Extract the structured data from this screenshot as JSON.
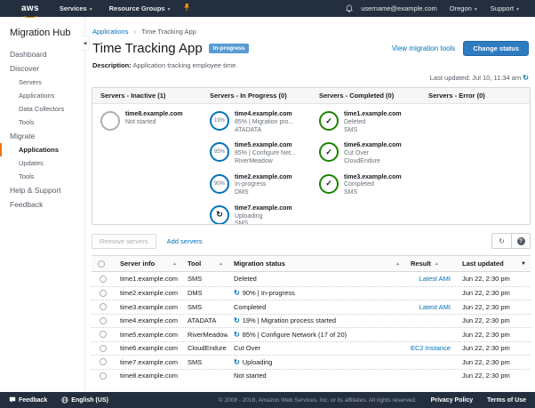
{
  "colors": {
    "nav_bg": "#232f3e",
    "accent_orange": "#ec7211",
    "aws_smile": "#ff9900",
    "link_blue": "#0073bb",
    "primary_button": "#2d7bc0",
    "badge_blue": "#5a9bd5",
    "progress_ring": "#0073bb",
    "complete_ring": "#1d8102",
    "inactive_ring": "#aab0b5"
  },
  "topnav": {
    "logo": "aws",
    "services": "Services",
    "resource_groups": "Resource Groups",
    "user": "username@example.com",
    "region": "Oregon",
    "support": "Support"
  },
  "sidebar": {
    "title": "Migration Hub",
    "items": [
      {
        "label": "Dashboard",
        "level": 0,
        "active": false
      },
      {
        "label": "Discover",
        "level": 0,
        "active": false
      },
      {
        "label": "Servers",
        "level": 1,
        "active": false
      },
      {
        "label": "Applications",
        "level": 1,
        "active": false
      },
      {
        "label": "Data Collectors",
        "level": 1,
        "active": false
      },
      {
        "label": "Tools",
        "level": 1,
        "active": false
      },
      {
        "label": "Migrate",
        "level": 0,
        "active": false
      },
      {
        "label": "Applications",
        "level": 1,
        "active": true
      },
      {
        "label": "Updates",
        "level": 1,
        "active": false
      },
      {
        "label": "Tools",
        "level": 1,
        "active": false
      },
      {
        "label": "Help & Support",
        "level": 0,
        "active": false
      },
      {
        "label": "Feedback",
        "level": 0,
        "active": false
      }
    ]
  },
  "header": {
    "breadcrumb_parent": "Applications",
    "breadcrumb_current": "Time Tracking App",
    "title": "Time Tracking App",
    "status_badge": "In-progress",
    "view_tools_link": "View migration tools",
    "change_status_button": "Change status",
    "description_label": "Description:",
    "description": "Application tracking employee time.",
    "last_updated": "Last updated: Jul 10, 11:34 am"
  },
  "status_panel": {
    "columns": [
      {
        "header": "Servers - Inactive (1)",
        "servers": [
          {
            "name": "time8.example.com",
            "line2": "Not started",
            "line3": "",
            "icon": "empty",
            "percent": ""
          }
        ]
      },
      {
        "header": "Servers - In Progress (0)",
        "servers": [
          {
            "name": "time4.example.com",
            "line2": "85% | Migration pro...",
            "line3": "ATADATA",
            "icon": "percent",
            "percent": "19%"
          },
          {
            "name": "time5.example.com",
            "line2": "85% | Configure Net...",
            "line3": "RiverMeadow",
            "icon": "percent",
            "percent": "85%"
          },
          {
            "name": "time2.example.com",
            "line2": "In-progress",
            "line3": "DMS",
            "icon": "percent",
            "percent": "90%"
          },
          {
            "name": "time7.example.com",
            "line2": "Uploading",
            "line3": "SMS",
            "icon": "refresh",
            "percent": ""
          }
        ]
      },
      {
        "header": "Servers - Completed (0)",
        "servers": [
          {
            "name": "time1.example.com",
            "line2": "Deleted",
            "line3": "SMS",
            "icon": "check",
            "percent": ""
          },
          {
            "name": "time6.example.com",
            "line2": "Cut Over",
            "line3": "CloudEndure",
            "icon": "check",
            "percent": ""
          },
          {
            "name": "time3.example.com",
            "line2": "Completed",
            "line3": "SMS",
            "icon": "check",
            "percent": ""
          }
        ]
      },
      {
        "header": "Servers - Error (0)",
        "servers": []
      }
    ]
  },
  "actions": {
    "remove_servers": "Remove servers",
    "add_servers": "Add servers"
  },
  "table": {
    "headers": {
      "server": "Server info",
      "tool": "Tool",
      "status": "Migration status",
      "result": "Result",
      "updated": "Last updated"
    },
    "rows": [
      {
        "server": "time1.example.com",
        "tool": "SMS",
        "status": "Deleted",
        "spinner": false,
        "result": "Latest AMI",
        "updated": "Jun 22, 2:30 pm"
      },
      {
        "server": "time2.example.com",
        "tool": "DMS",
        "status": "90% | In-progress",
        "spinner": true,
        "result": "",
        "updated": "Jun 22, 2:30 pm"
      },
      {
        "server": "time3.example.com",
        "tool": "SMS",
        "status": "Completed",
        "spinner": false,
        "result": "Latest AMI",
        "updated": "Jun 22, 2:30 pm"
      },
      {
        "server": "time4.example.com",
        "tool": "ATADATA",
        "status": "19% | Migration process started",
        "spinner": true,
        "result": "",
        "updated": "Jun 22, 2:30 pm"
      },
      {
        "server": "time5.example.com",
        "tool": "RiverMeadow",
        "status": "85% | Configure Network (17 of 20)",
        "spinner": true,
        "result": "",
        "updated": "Jun 22, 2:30 pm"
      },
      {
        "server": "time6.example.com",
        "tool": "CloudEndure",
        "status": "Cut Over",
        "spinner": false,
        "result": "EC2 Instance",
        "updated": "Jun 22, 2:30 pm"
      },
      {
        "server": "time7.example.com",
        "tool": "SMS",
        "status": "Uploading",
        "spinner": true,
        "result": "",
        "updated": "Jun 22, 2:30 pm"
      },
      {
        "server": "time8.example.com",
        "tool": "",
        "status": "Not started",
        "spinner": false,
        "result": "",
        "updated": "Jun 22, 2:30 pm"
      }
    ]
  },
  "footer": {
    "feedback": "Feedback",
    "language": "English (US)",
    "copyright": "© 2008 - 2018, Amazon Web Services, Inc. or its affiliates. All rights reserved.",
    "privacy": "Privacy Policy",
    "terms": "Terms of Use"
  }
}
